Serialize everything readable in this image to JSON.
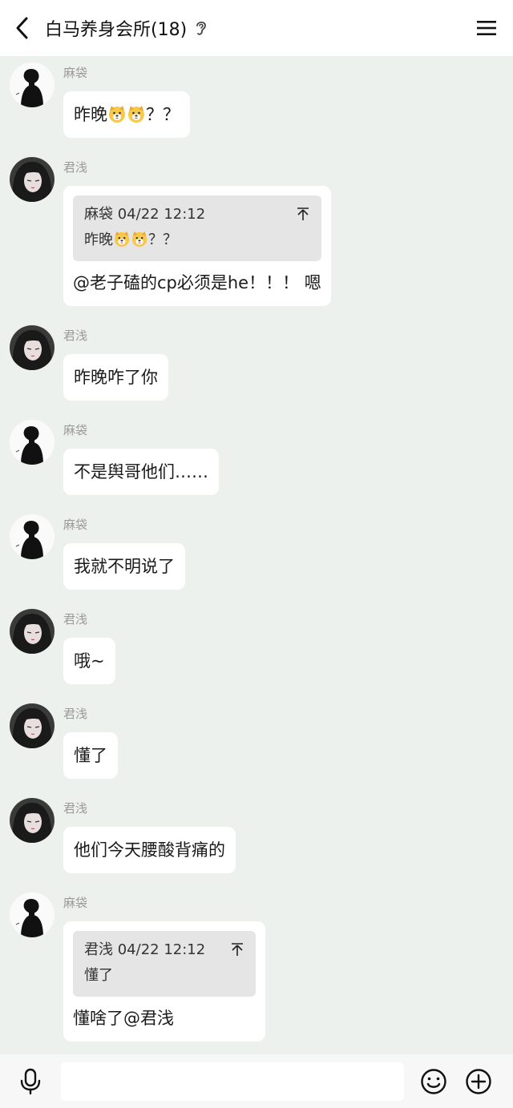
{
  "header": {
    "title": "白马养身会所(18)",
    "back_icon": "chevron-left-icon",
    "ear_icon": "ear-icon",
    "menu_icon": "hamburger-menu-icon"
  },
  "messages": [
    {
      "sender": "麻袋",
      "avatar": "avatar-madai",
      "text": "昨晚",
      "emoji_count": 2,
      "suffix": "？？"
    },
    {
      "sender": "君浅",
      "avatar": "avatar-junqian",
      "quote": {
        "head": "麻袋 04/22 12:12",
        "text": "昨晚",
        "emoji_count": 2,
        "suffix": "？？"
      },
      "text": "@老子磕的cp必须是he！！！ 嗯"
    },
    {
      "sender": "君浅",
      "avatar": "avatar-junqian",
      "text": "昨晚咋了你"
    },
    {
      "sender": "麻袋",
      "avatar": "avatar-madai",
      "text": "不是舆哥他们……"
    },
    {
      "sender": "麻袋",
      "avatar": "avatar-madai",
      "text": "我就不明说了"
    },
    {
      "sender": "君浅",
      "avatar": "avatar-junqian",
      "text": "哦~"
    },
    {
      "sender": "君浅",
      "avatar": "avatar-junqian",
      "text": "懂了"
    },
    {
      "sender": "君浅",
      "avatar": "avatar-junqian",
      "text": "他们今天腰酸背痛的"
    },
    {
      "sender": "麻袋",
      "avatar": "avatar-madai",
      "quote": {
        "head": "君浅 04/22 12:12",
        "text": "懂了"
      },
      "text": "懂啥了@君浅"
    }
  ],
  "footer": {
    "input_value": "",
    "mic_icon": "microphone-icon",
    "emoji_icon": "smiley-icon",
    "plus_icon": "plus-circle-icon"
  },
  "colors": {
    "background": "#edf1ed",
    "bubble": "#ffffff",
    "quote_bg": "#e5e5e5",
    "sender": "#9a9a9a"
  }
}
